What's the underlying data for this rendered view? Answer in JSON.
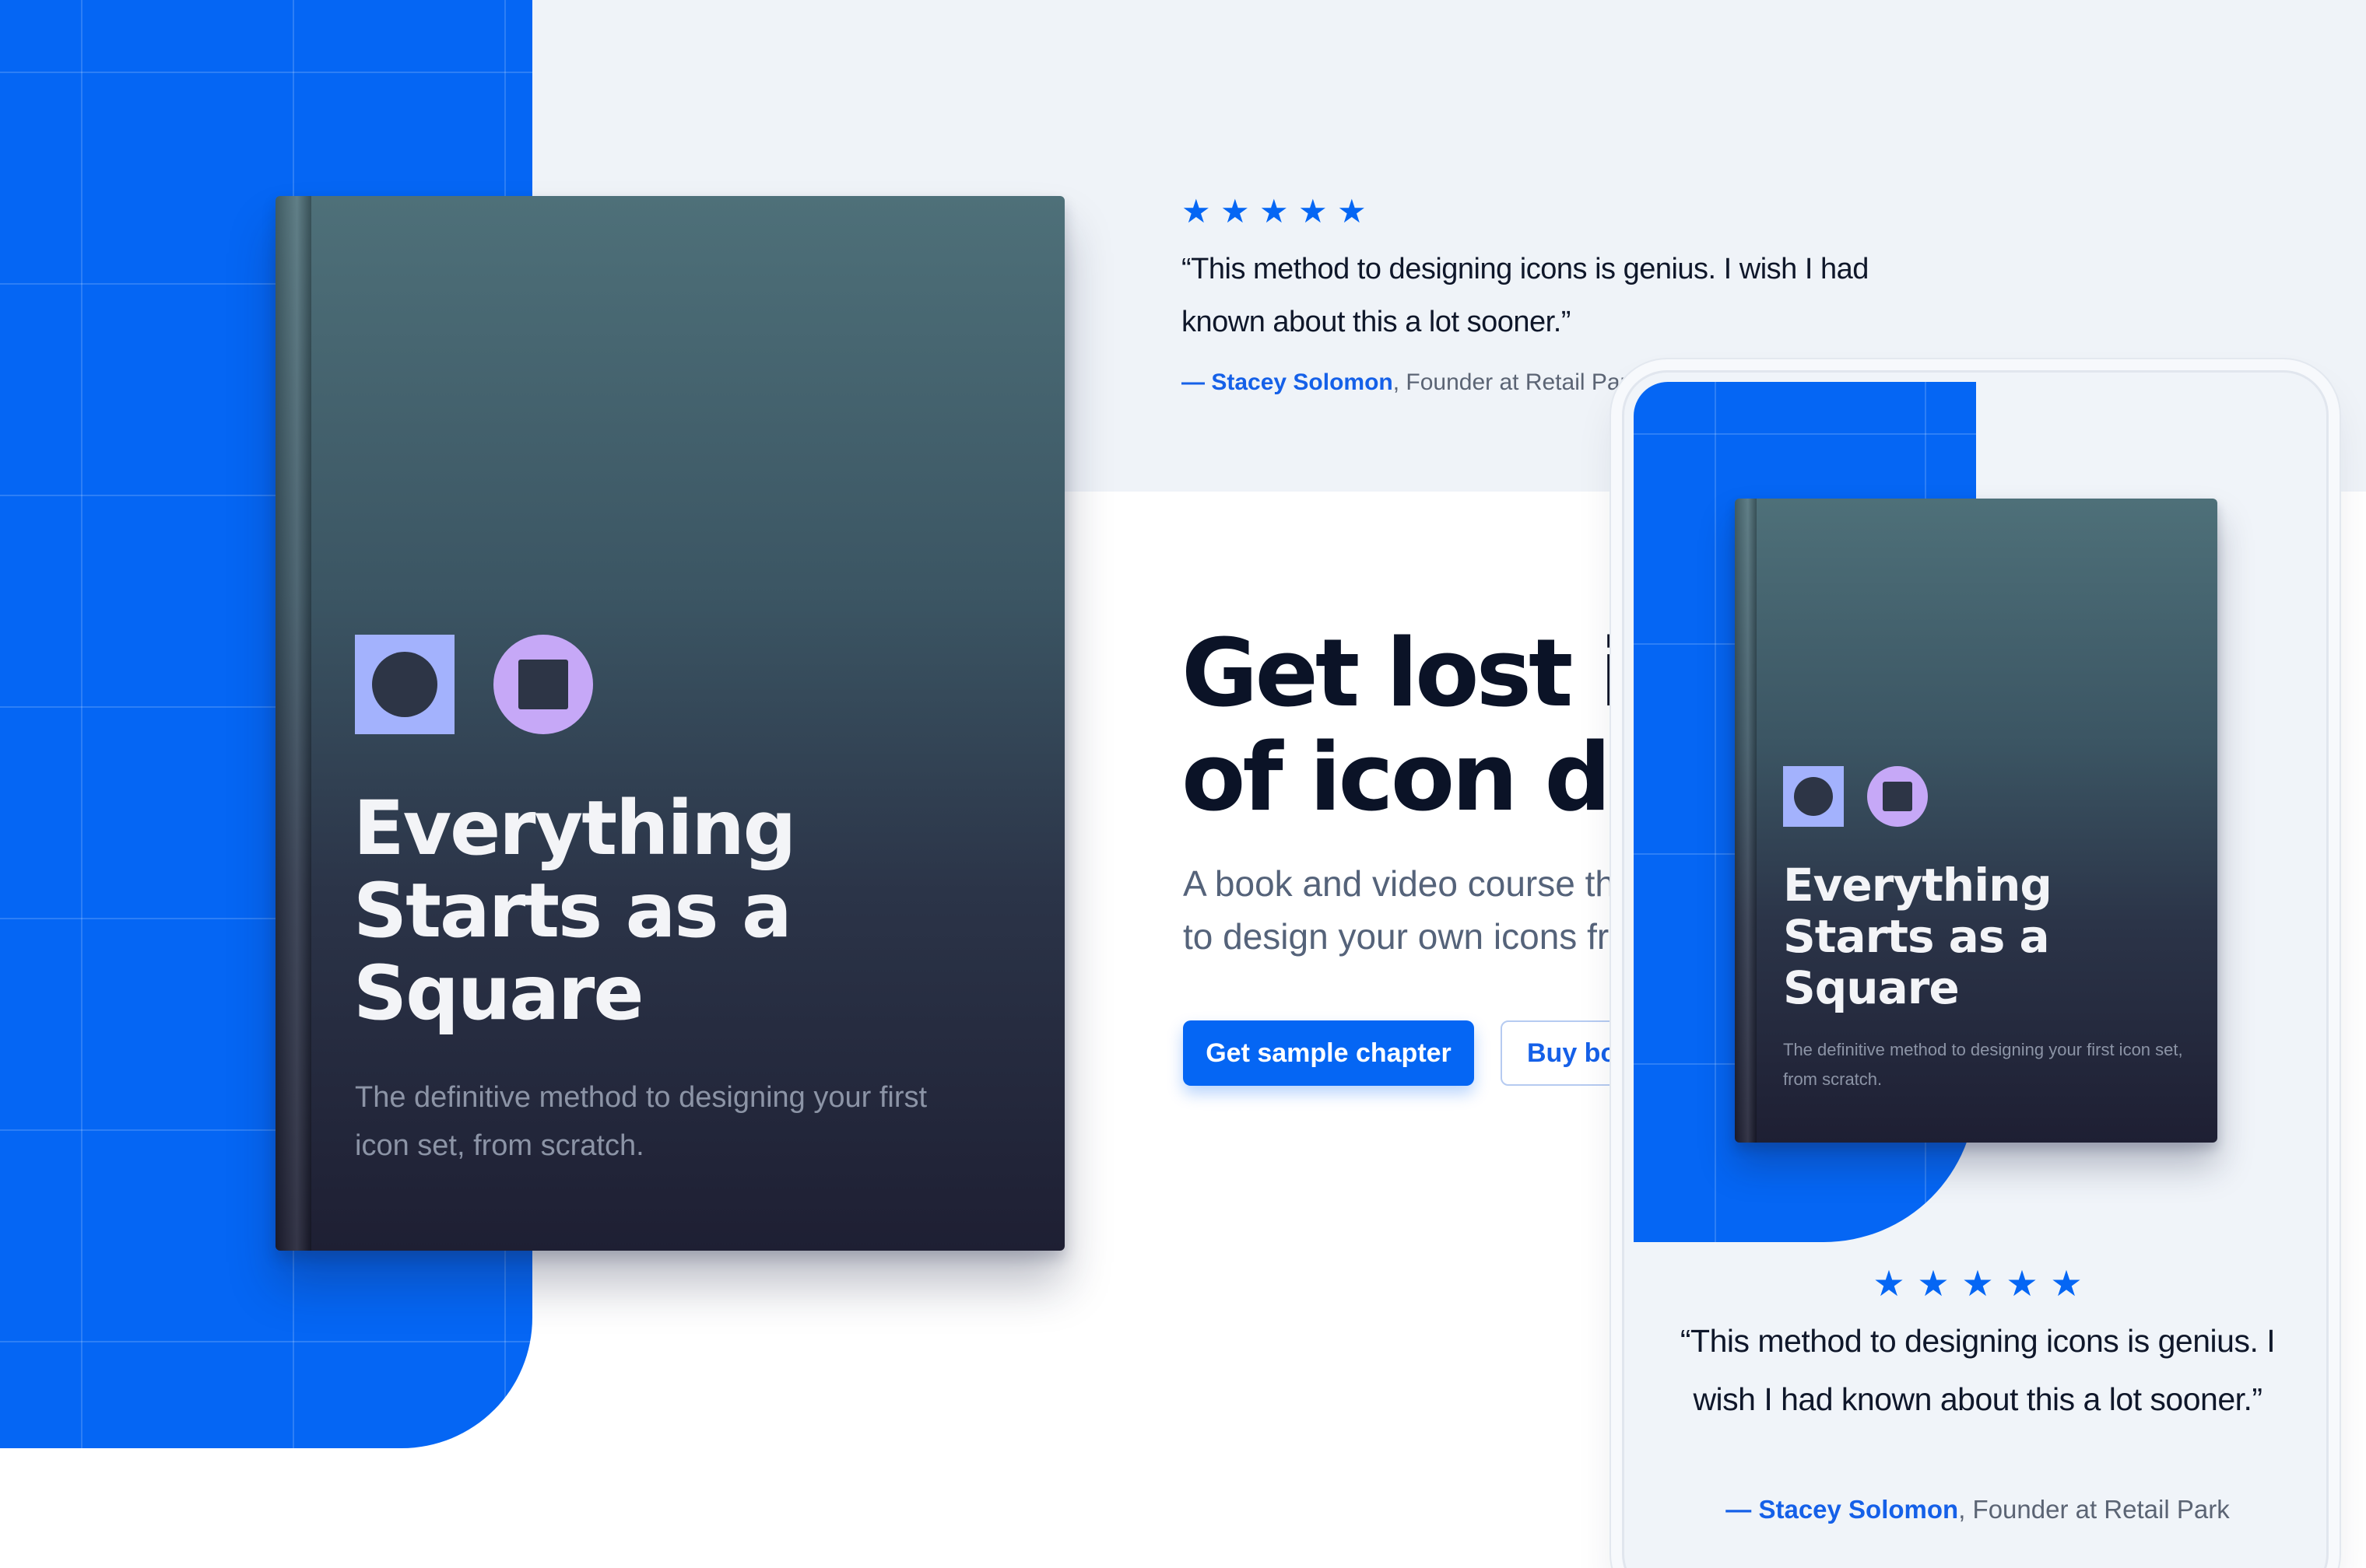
{
  "colors": {
    "brand_blue": "#0566f4",
    "page_top_background": "#eff3f8",
    "heading_text": "#0b1327",
    "book_gradient_top": "#4e7079",
    "book_gradient_bottom": "#1e1f33",
    "shape_square": "#a3b2fd",
    "shape_circle": "#c6a8f7"
  },
  "book": {
    "title_lines": [
      "Everything",
      "Starts as a",
      "Square"
    ],
    "subtitle": "The definitive method to designing your first icon set, from scratch.",
    "icons": [
      "square-with-circle-icon",
      "circle-with-square-icon"
    ]
  },
  "testimonial": {
    "rating": 5,
    "stars": [
      "★",
      "★",
      "★",
      "★",
      "★"
    ],
    "quote": "“This method to designing icons is genius. I wish I had known about this a lot sooner.”",
    "author": "— Stacey Solomon",
    "role": ", Founder at Retail Park"
  },
  "hero": {
    "title_lines": [
      "Get lost in the world",
      "of icon design"
    ],
    "subtitle": "A book and video course that teaches you how to design your own icons from scratch.",
    "primary_button": "Get sample chapter",
    "secondary_button": "Buy book"
  }
}
